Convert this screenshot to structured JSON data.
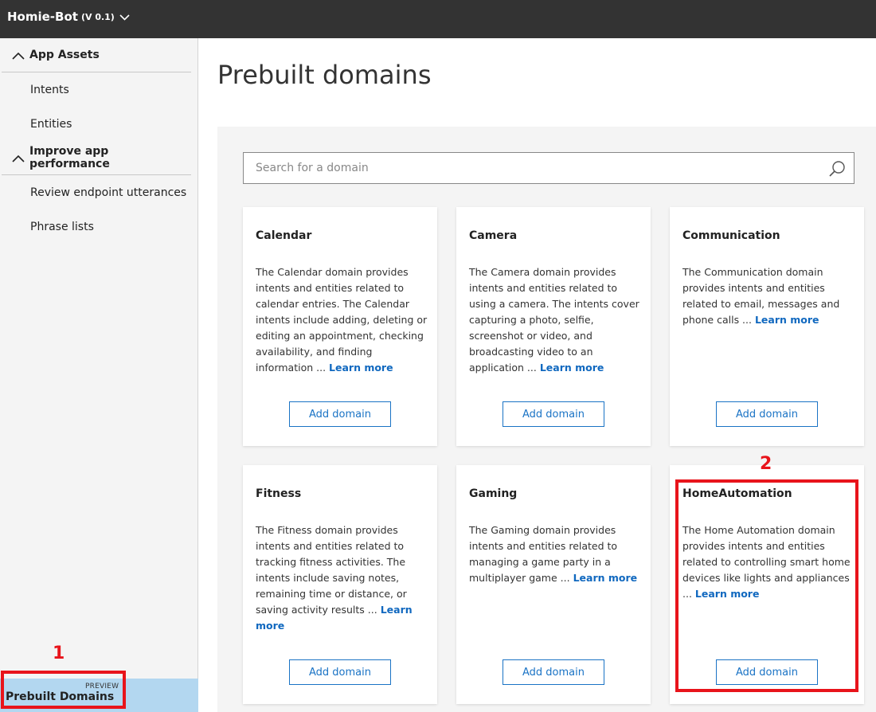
{
  "header": {
    "app_name": "Homie-Bot",
    "version": "(V 0.1)",
    "dropdown_icon": "chevron-down-icon"
  },
  "sidebar": {
    "sections": [
      {
        "label": "App Assets",
        "icon": "chevron-up-icon",
        "items": [
          {
            "label": "Intents"
          },
          {
            "label": "Entities"
          }
        ]
      },
      {
        "label": "Improve app performance",
        "icon": "chevron-up-icon",
        "items": [
          {
            "label": "Review endpoint utterances"
          },
          {
            "label": "Phrase lists"
          }
        ]
      }
    ],
    "active_item": {
      "label": "Prebuilt Domains",
      "badge": "PREVIEW",
      "highlight_color": "#b3d7f0"
    }
  },
  "main": {
    "title": "Prebuilt domains",
    "search": {
      "placeholder": "Search for a domain",
      "icon": "search-icon"
    },
    "cards": [
      {
        "title": "Calendar",
        "description": "The Calendar domain provides intents and entities related to calendar entries. The Calendar intents include adding, deleting or editing an appointment, checking availability, and finding information ...",
        "learn_more": "Learn more",
        "button": "Add domain"
      },
      {
        "title": "Camera",
        "description": "The Camera domain provides intents and entities related to using a camera. The intents cover capturing a photo, selfie, screenshot or video, and broadcasting video to an application ...",
        "learn_more": "Learn more",
        "button": "Add domain"
      },
      {
        "title": "Communication",
        "description": "The Communication domain provides intents and entities related to email, messages and phone calls ...",
        "learn_more": "Learn more",
        "button": "Add domain"
      },
      {
        "title": "Fitness",
        "description": "The Fitness domain provides intents and entities related to tracking fitness activities. The intents include saving notes, remaining time or distance, or saving activity results ...",
        "learn_more": "Learn more",
        "button": "Add domain"
      },
      {
        "title": "Gaming",
        "description": "The Gaming domain provides intents and entities related to managing a game party in a multiplayer game ...",
        "learn_more": "Learn more",
        "button": "Add domain"
      },
      {
        "title": "HomeAutomation",
        "description": "The Home Automation domain provides intents and entities related to controlling smart home devices like lights and appliances ...",
        "learn_more": "Learn more",
        "button": "Add domain"
      }
    ]
  },
  "annotations": {
    "marker_1": "1",
    "marker_2": "2",
    "color": "#e8141b"
  }
}
